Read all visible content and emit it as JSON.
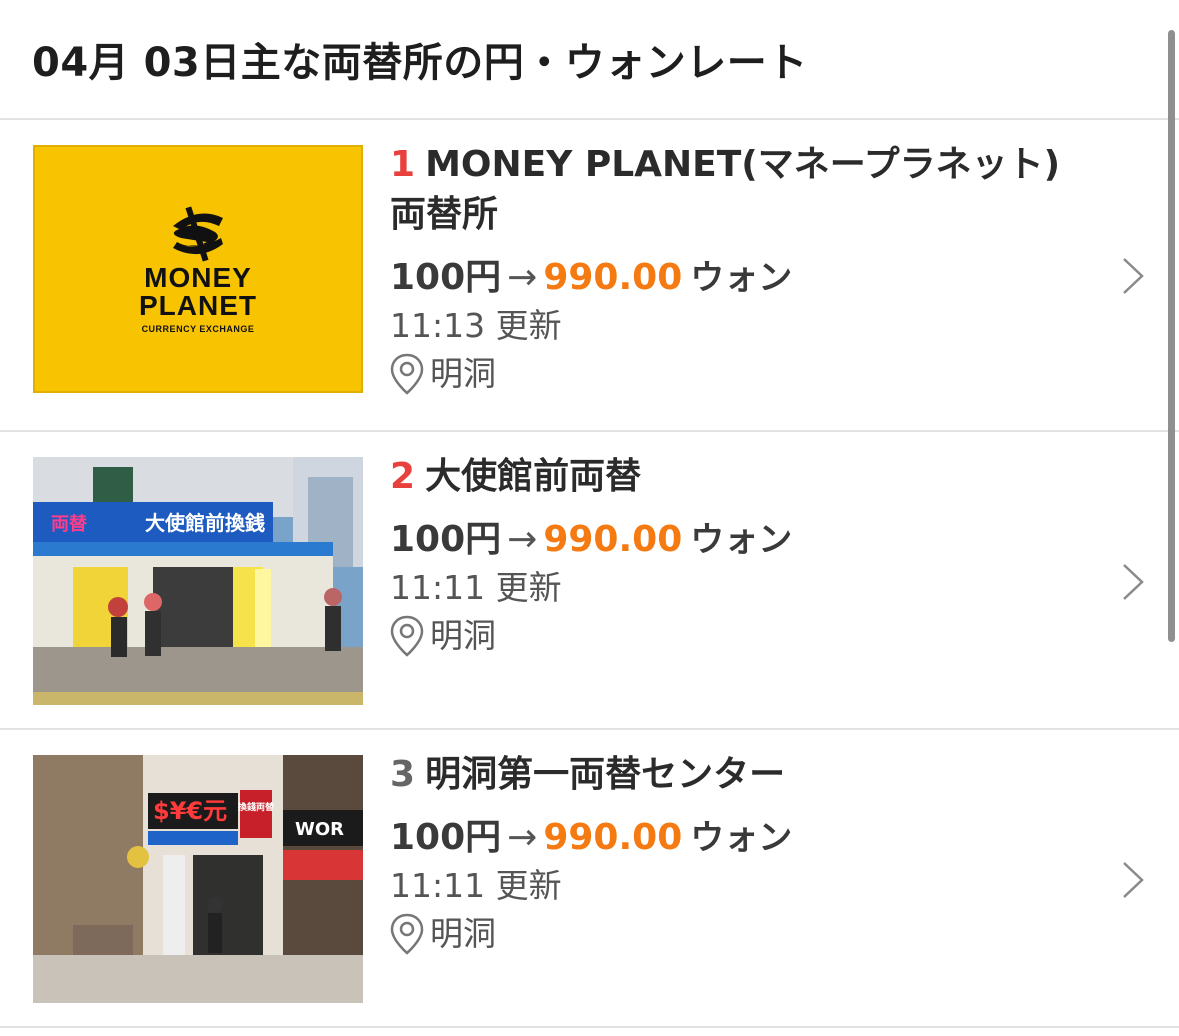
{
  "header": {
    "title": "04月 03日主な両替所の円・ウォンレート"
  },
  "items": [
    {
      "rank": "1",
      "name": "MONEY PLANET(マネープラネット)両替所",
      "rate_from": "100円",
      "arrow": "→",
      "rate_amount": "990.00",
      "rate_unit": "ウォン",
      "updated": "11:13 更新",
      "location": "明洞",
      "logo": {
        "line1": "MONEY",
        "line2": "PLANET",
        "sub": "CURRENCY EXCHANGE"
      }
    },
    {
      "rank": "2",
      "name": "大使館前両替",
      "rate_from": "100円",
      "arrow": "→",
      "rate_amount": "990.00",
      "rate_unit": "ウォン",
      "updated": "11:11 更新",
      "location": "明洞",
      "photo": {
        "sign": "大使館前換銭",
        "side_sign": "両替",
        "panel_text": "大使館前換銭"
      }
    },
    {
      "rank": "3",
      "name": "明洞第一両替センター",
      "rate_from": "100円",
      "arrow": "→",
      "rate_amount": "990.00",
      "rate_unit": "ウォン",
      "updated": "11:11 更新",
      "location": "明洞",
      "photo": {
        "sign": "$¥€元",
        "side_sign": "換錢両替",
        "store_sign": "WOR"
      }
    }
  ],
  "colors": {
    "accent": "#f47a11",
    "rank_red": "#e8403c",
    "rank_gray": "#666666",
    "logo_yellow": "#f8c402"
  },
  "icons": {
    "location": "map-pin-icon",
    "chevron": "chevron-right-icon"
  }
}
